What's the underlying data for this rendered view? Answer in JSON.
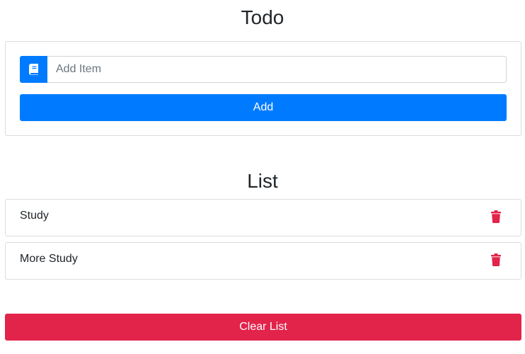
{
  "todo": {
    "title": "Todo",
    "input": {
      "placeholder": "Add Item",
      "value": "",
      "icon": "book-icon"
    },
    "add_label": "Add"
  },
  "list": {
    "title": "List",
    "items": [
      {
        "label": "Study",
        "icon": "trash-icon"
      },
      {
        "label": "More Study",
        "icon": "trash-icon"
      }
    ],
    "clear_label": "Clear List"
  },
  "colors": {
    "primary": "#007bff",
    "danger": "#e2234a",
    "border": "#dcdcdc",
    "text": "#212529"
  }
}
